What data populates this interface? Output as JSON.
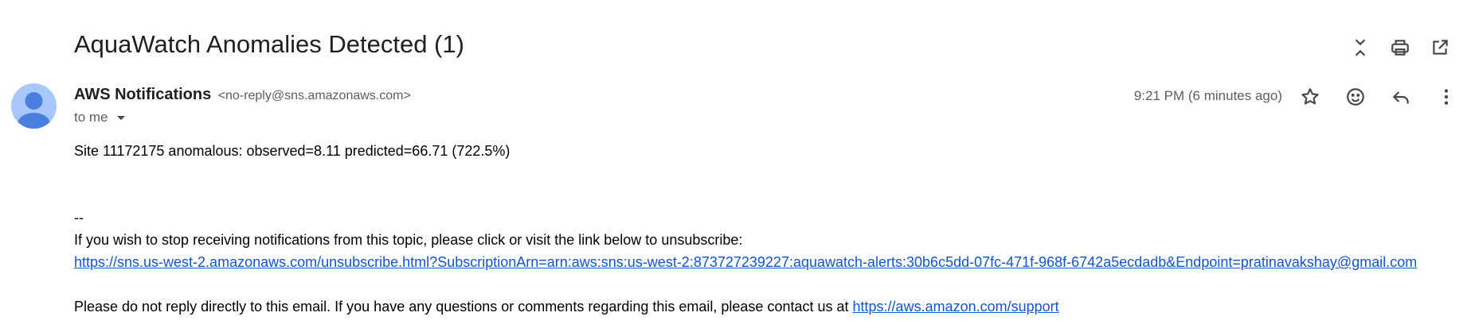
{
  "email": {
    "subject": "AquaWatch Anomalies Detected (1)",
    "sender_name": "AWS Notifications",
    "sender_email": "<no-reply@sns.amazonaws.com>",
    "recipient": "to me",
    "time": "9:21 PM (6 minutes ago)",
    "body": {
      "line1": "Site 11172175 anomalous: observed=8.11 predicted=66.71 (722.5%)",
      "separator": "--",
      "unsubscribe_text": "If you wish to stop receiving notifications from this topic, please click or visit the link below to unsubscribe:",
      "unsubscribe_link": "https://sns.us-west-2.amazonaws.com/unsubscribe.html?SubscriptionArn=arn:aws:sns:us-west-2:873727239227:aquawatch-alerts:30b6c5dd-07fc-471f-968f-6742a5ecdadb&Endpoint=pratinavakshay@gmail.com",
      "contact_text": "Please do not reply directly to this email. If you have any questions or comments regarding this email, please contact us at",
      "contact_link": "https://aws.amazon.com/support"
    }
  },
  "icons": {
    "top": [
      "collapse-icon",
      "print-icon",
      "open-in-new-window-icon"
    ],
    "message": [
      "star-icon",
      "emoji-icon",
      "reply-icon",
      "more-vert-icon"
    ]
  },
  "colors": {
    "avatar_bg": "#a8c7fa",
    "avatar_fg": "#4a7fe0",
    "link": "#1155cc"
  }
}
